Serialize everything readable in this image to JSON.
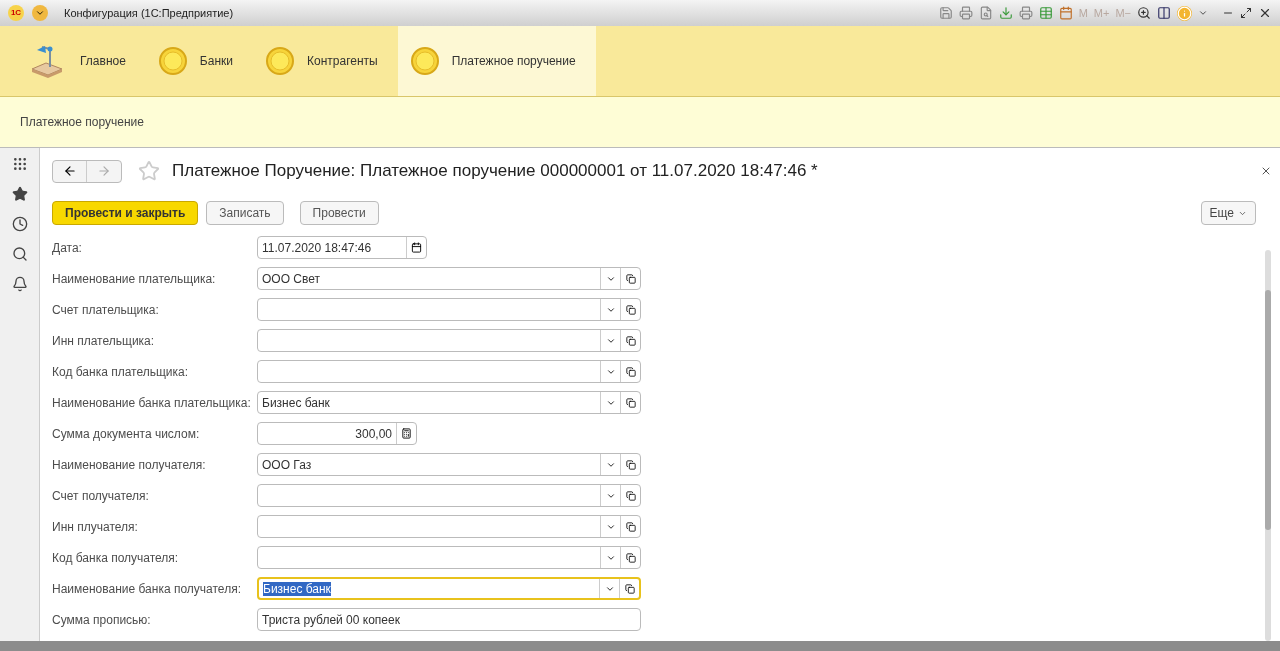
{
  "window": {
    "title": "Конфигурация  (1С:Предприятие)",
    "logo": "1С",
    "memory_buttons": [
      "M",
      "M+",
      "M−"
    ]
  },
  "sections": [
    {
      "label": "Главное",
      "kind": "home",
      "selected": false
    },
    {
      "label": "Банки",
      "kind": "circle",
      "selected": false
    },
    {
      "label": "Контрагенты",
      "kind": "circle",
      "selected": false
    },
    {
      "label": "Платежное поручение",
      "kind": "circle",
      "selected": true
    }
  ],
  "subsection": "Платежное поручение",
  "form": {
    "title": "Платежное Поручение: Платежное поручение 000000001 от 11.07.2020 18:47:46 *",
    "buttons": [
      {
        "label": "Провести и закрыть",
        "primary": true
      },
      {
        "label": "Записать",
        "primary": false
      },
      {
        "label": "Провести",
        "primary": false
      }
    ],
    "more_button": "Еще",
    "fields": [
      {
        "label": "Дата:",
        "kind": "date",
        "value": "11.07.2020 18:47:46",
        "focused": false
      },
      {
        "label": "Наименование плательщика:",
        "kind": "select",
        "value": "ООО Свет",
        "focused": false
      },
      {
        "label": "Счет плательщика:",
        "kind": "select",
        "focused": false
      },
      {
        "label": "Инн плательщика:",
        "kind": "select",
        "focused": false
      },
      {
        "label": "Код банка плательщика:",
        "kind": "select",
        "focused": false
      },
      {
        "label": "Наименование банка плательщика:",
        "kind": "select",
        "value": "Бизнес банк",
        "focused": false
      },
      {
        "label": "Сумма документа числом:",
        "kind": "number",
        "value": "300,00",
        "focused": false
      },
      {
        "label": "Наименование получателя:",
        "kind": "select",
        "value": "ООО Газ",
        "focused": false
      },
      {
        "label": "Счет получателя:",
        "kind": "select",
        "focused": false
      },
      {
        "label": "Инн плучателя:",
        "kind": "select",
        "focused": false
      },
      {
        "label": "Код банка получателя:",
        "kind": "select",
        "focused": false
      },
      {
        "label": "Наименование банка получателя:",
        "kind": "select",
        "value": "Бизнес банк",
        "focused": true
      },
      {
        "label": "Сумма прописью:",
        "kind": "text",
        "value": "Триста рублей 00 копеек",
        "focused": false
      }
    ]
  }
}
